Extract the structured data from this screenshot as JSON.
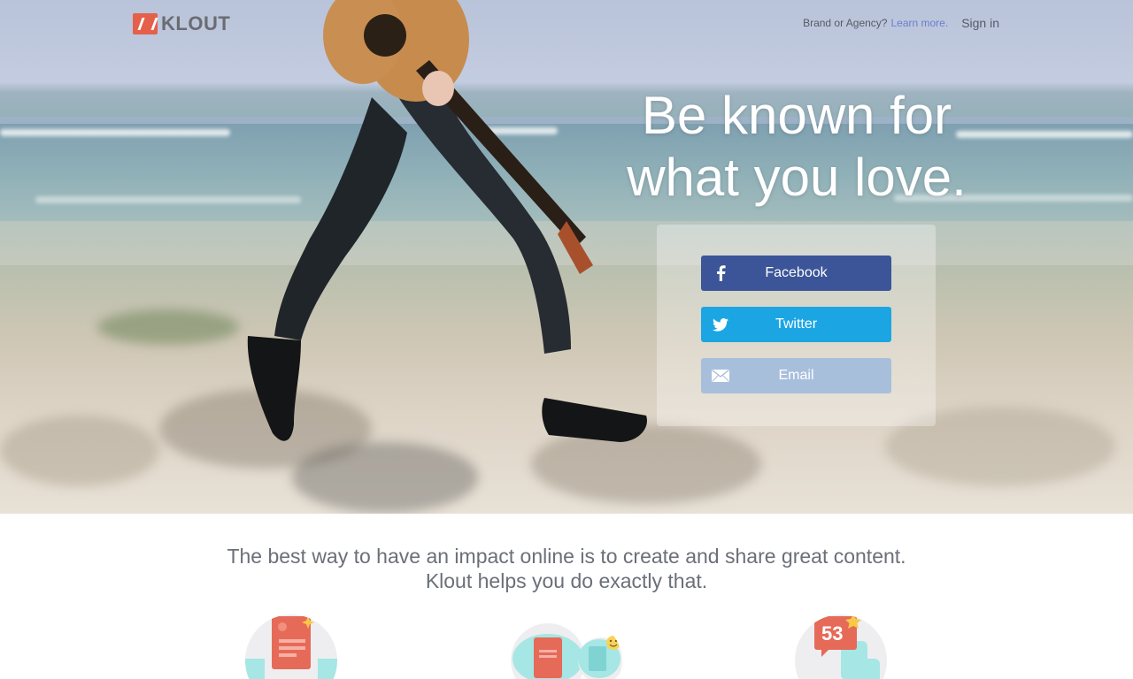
{
  "brand": {
    "name": "KLOUT",
    "logo_icon": "klout-k-icon",
    "accent": "#e4604a"
  },
  "topnav": {
    "brand_prompt": "Brand or Agency?",
    "learn_more": "Learn more.",
    "sign_in": "Sign in"
  },
  "hero": {
    "headline_line1": "Be known for",
    "headline_line2": "what you love."
  },
  "signup": {
    "buttons": [
      {
        "label": "Facebook",
        "icon": "facebook-icon",
        "color": "#3b5598"
      },
      {
        "label": "Twitter",
        "icon": "twitter-icon",
        "color": "#1ba6e3"
      },
      {
        "label": "Email",
        "icon": "envelope-icon",
        "color": "#a8bfdc"
      }
    ]
  },
  "intro": {
    "line1": "The best way to have an impact online is to create and share great content.",
    "line2": "Klout helps you do exactly that."
  },
  "features": [
    {
      "icon": "document-sparkle-icon"
    },
    {
      "icon": "documents-smiley-icon"
    },
    {
      "icon": "score-badge-icon",
      "score": "53"
    }
  ]
}
